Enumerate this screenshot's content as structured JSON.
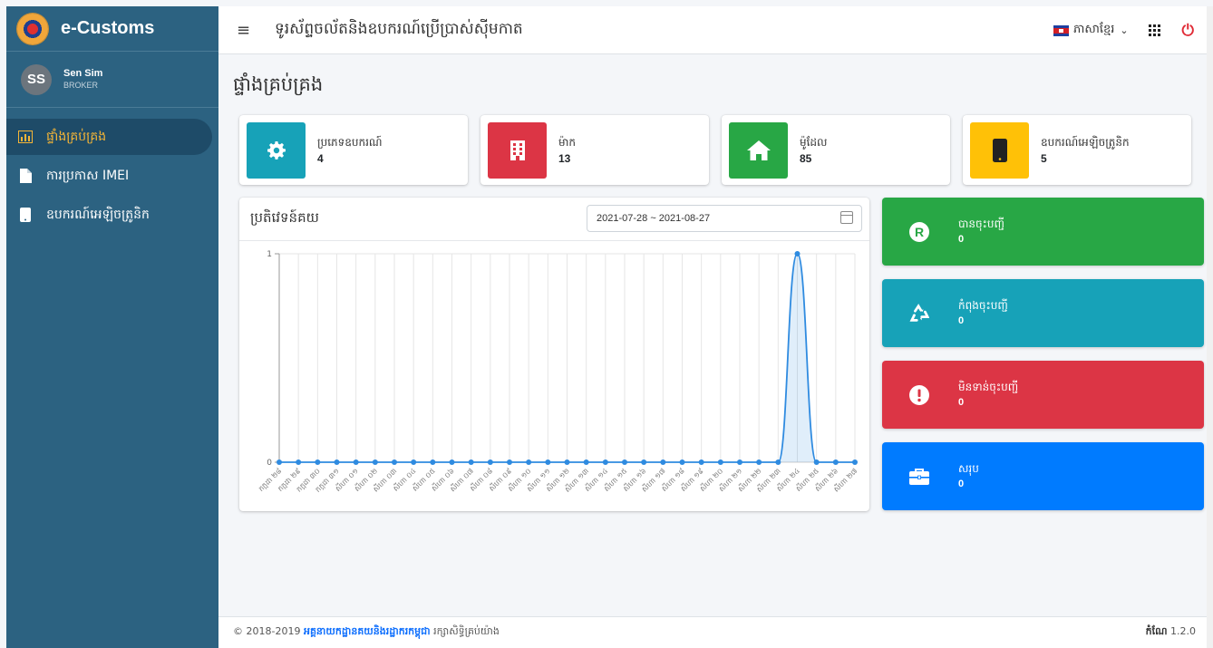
{
  "brand": {
    "name": "e-Customs"
  },
  "user": {
    "initials": "SS",
    "name": "Sen Sim",
    "role": "BROKER"
  },
  "sidebar": {
    "items": [
      {
        "label": "ផ្ទាំងគ្រប់គ្រង",
        "active": true
      },
      {
        "label": "ការប្រកាស IMEI",
        "active": false
      },
      {
        "label": "ឧបករណ៍អេឡិចត្រូនិក",
        "active": false
      }
    ]
  },
  "topbar": {
    "title": "ទូរស័ព្ទចល័តនិងឧបករណ៍ប្រើប្រាស់ស៊ីមកាត",
    "language": "ភាសាខ្មែរ"
  },
  "page": {
    "title": "ផ្ទាំងគ្រប់គ្រង"
  },
  "info_boxes": [
    {
      "label": "ប្រភេទឧបករណ៍",
      "value": "4",
      "color": "#17a2b8",
      "icon": "gear-icon"
    },
    {
      "label": "ម៉ាក",
      "value": "13",
      "color": "#dc3545",
      "icon": "building-icon"
    },
    {
      "label": "ម៉ូដែល",
      "value": "85",
      "color": "#28a745",
      "icon": "home-icon"
    },
    {
      "label": "ឧបករណ៍អេឡិចត្រូនិក",
      "value": "5",
      "color": "#ffc107",
      "icon": "mobile-icon"
    }
  ],
  "chart_card": {
    "title": "ប្រតិវេទន៍គយ",
    "date_range": "2021-07-28 ~ 2021-08-27"
  },
  "chart_data": {
    "type": "area",
    "x": [
      "កក្កដា ២៨",
      "កក្កដា ២៩",
      "កក្កដា ៣០",
      "កក្កដា ៣១",
      "សីហា ០១",
      "សីហា ០២",
      "សីហា ០៣",
      "សីហា ០៤",
      "សីហា ០៥",
      "សីហា ០៦",
      "សីហា ០៧",
      "សីហា ០៨",
      "សីហា ០៩",
      "សីហា ១០",
      "សីហា ១១",
      "សីហា ១២",
      "សីហា ១៣",
      "សីហា ១៤",
      "សីហា ១៥",
      "សីហា ១៦",
      "សីហា ១៧",
      "សីហា ១៨",
      "សីហា ១៩",
      "សីហា ២០",
      "សីហា ២១",
      "សីហា ២២",
      "សីហា ២៣",
      "សីហា ២៤",
      "សីហា ២៥",
      "សីហា ២៦",
      "សីហា ២៧"
    ],
    "values": [
      0,
      0,
      0,
      0,
      0,
      0,
      0,
      0,
      0,
      0,
      0,
      0,
      0,
      0,
      0,
      0,
      0,
      0,
      0,
      0,
      0,
      0,
      0,
      0,
      0,
      0,
      0,
      1,
      0,
      0,
      0
    ],
    "ylim": [
      0,
      1
    ],
    "yticks": [
      "0",
      "1"
    ],
    "color": "#2f8be0",
    "grid": true
  },
  "status_boxes": [
    {
      "label": "បានចុះបញ្ជី",
      "value": "0",
      "color": "#28a745",
      "icon": "registered-icon"
    },
    {
      "label": "កំពុងចុះបញ្ជី",
      "value": "0",
      "color": "#17a2b8",
      "icon": "recycle-icon"
    },
    {
      "label": "មិនទាន់ចុះបញ្ជី",
      "value": "0",
      "color": "#dc3545",
      "icon": "exclamation-icon"
    },
    {
      "label": "សរុប",
      "value": "0",
      "color": "#007bff",
      "icon": "briefcase-icon"
    }
  ],
  "footer": {
    "copyright": "© 2018-2019",
    "org": "អគ្គនាយកដ្ឋានគយនិងរដ្ឋាករកម្ពុជា",
    "rights": " រក្សាសិទ្ធិគ្រប់យ៉ាង",
    "version_label": "កំណែ",
    "version": "1.2.0"
  }
}
